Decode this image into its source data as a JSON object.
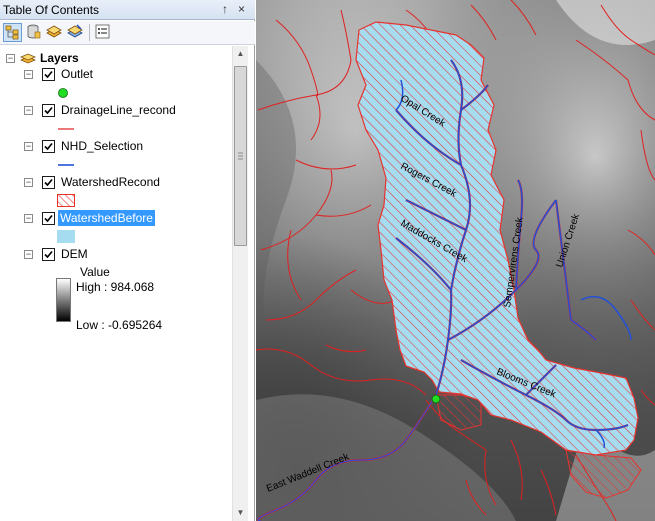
{
  "toc": {
    "title": "Table Of Contents",
    "pin_glyph": "↑",
    "close_glyph": "×",
    "toolbar": [
      {
        "icon": "list-by-drawing-order-icon"
      },
      {
        "icon": "list-by-source-icon"
      },
      {
        "icon": "list-by-visibility-icon"
      },
      {
        "icon": "list-by-selection-icon"
      },
      {
        "icon": "options-icon"
      }
    ],
    "root": {
      "label": "Layers",
      "icon": "layers-icon"
    },
    "layers": [
      {
        "label": "Outlet",
        "checked": true,
        "symbol": "green-point"
      },
      {
        "label": "DrainageLine_recond",
        "checked": true,
        "symbol": "red-line"
      },
      {
        "label": "NHD_Selection",
        "checked": true,
        "symbol": "blue-line"
      },
      {
        "label": "WatershedRecond",
        "checked": true,
        "symbol": "red-hatch-fill"
      },
      {
        "label": "WatershedBefore",
        "checked": true,
        "symbol": "light-blue-fill",
        "selected": true
      },
      {
        "label": "DEM",
        "checked": true,
        "symbol": "grayscale-ramp"
      }
    ],
    "dem_legend": {
      "field": "Value",
      "high": "High : 984.068",
      "low": "Low : -0.695264"
    }
  },
  "map": {
    "stream_labels": [
      "Opal Creek",
      "Rogers Creek",
      "Maddocks Creek",
      "Sempervirens Creek",
      "Union Creek",
      "Blooms Creek",
      "East Waddell Creek"
    ]
  },
  "colors": {
    "selection": "#3399ff",
    "watershed_fill": "#a6dcf0",
    "hatch": "#e8332e",
    "drainage": "#e02020",
    "nhd": "#2251d8",
    "outlet": "#22dd22"
  }
}
